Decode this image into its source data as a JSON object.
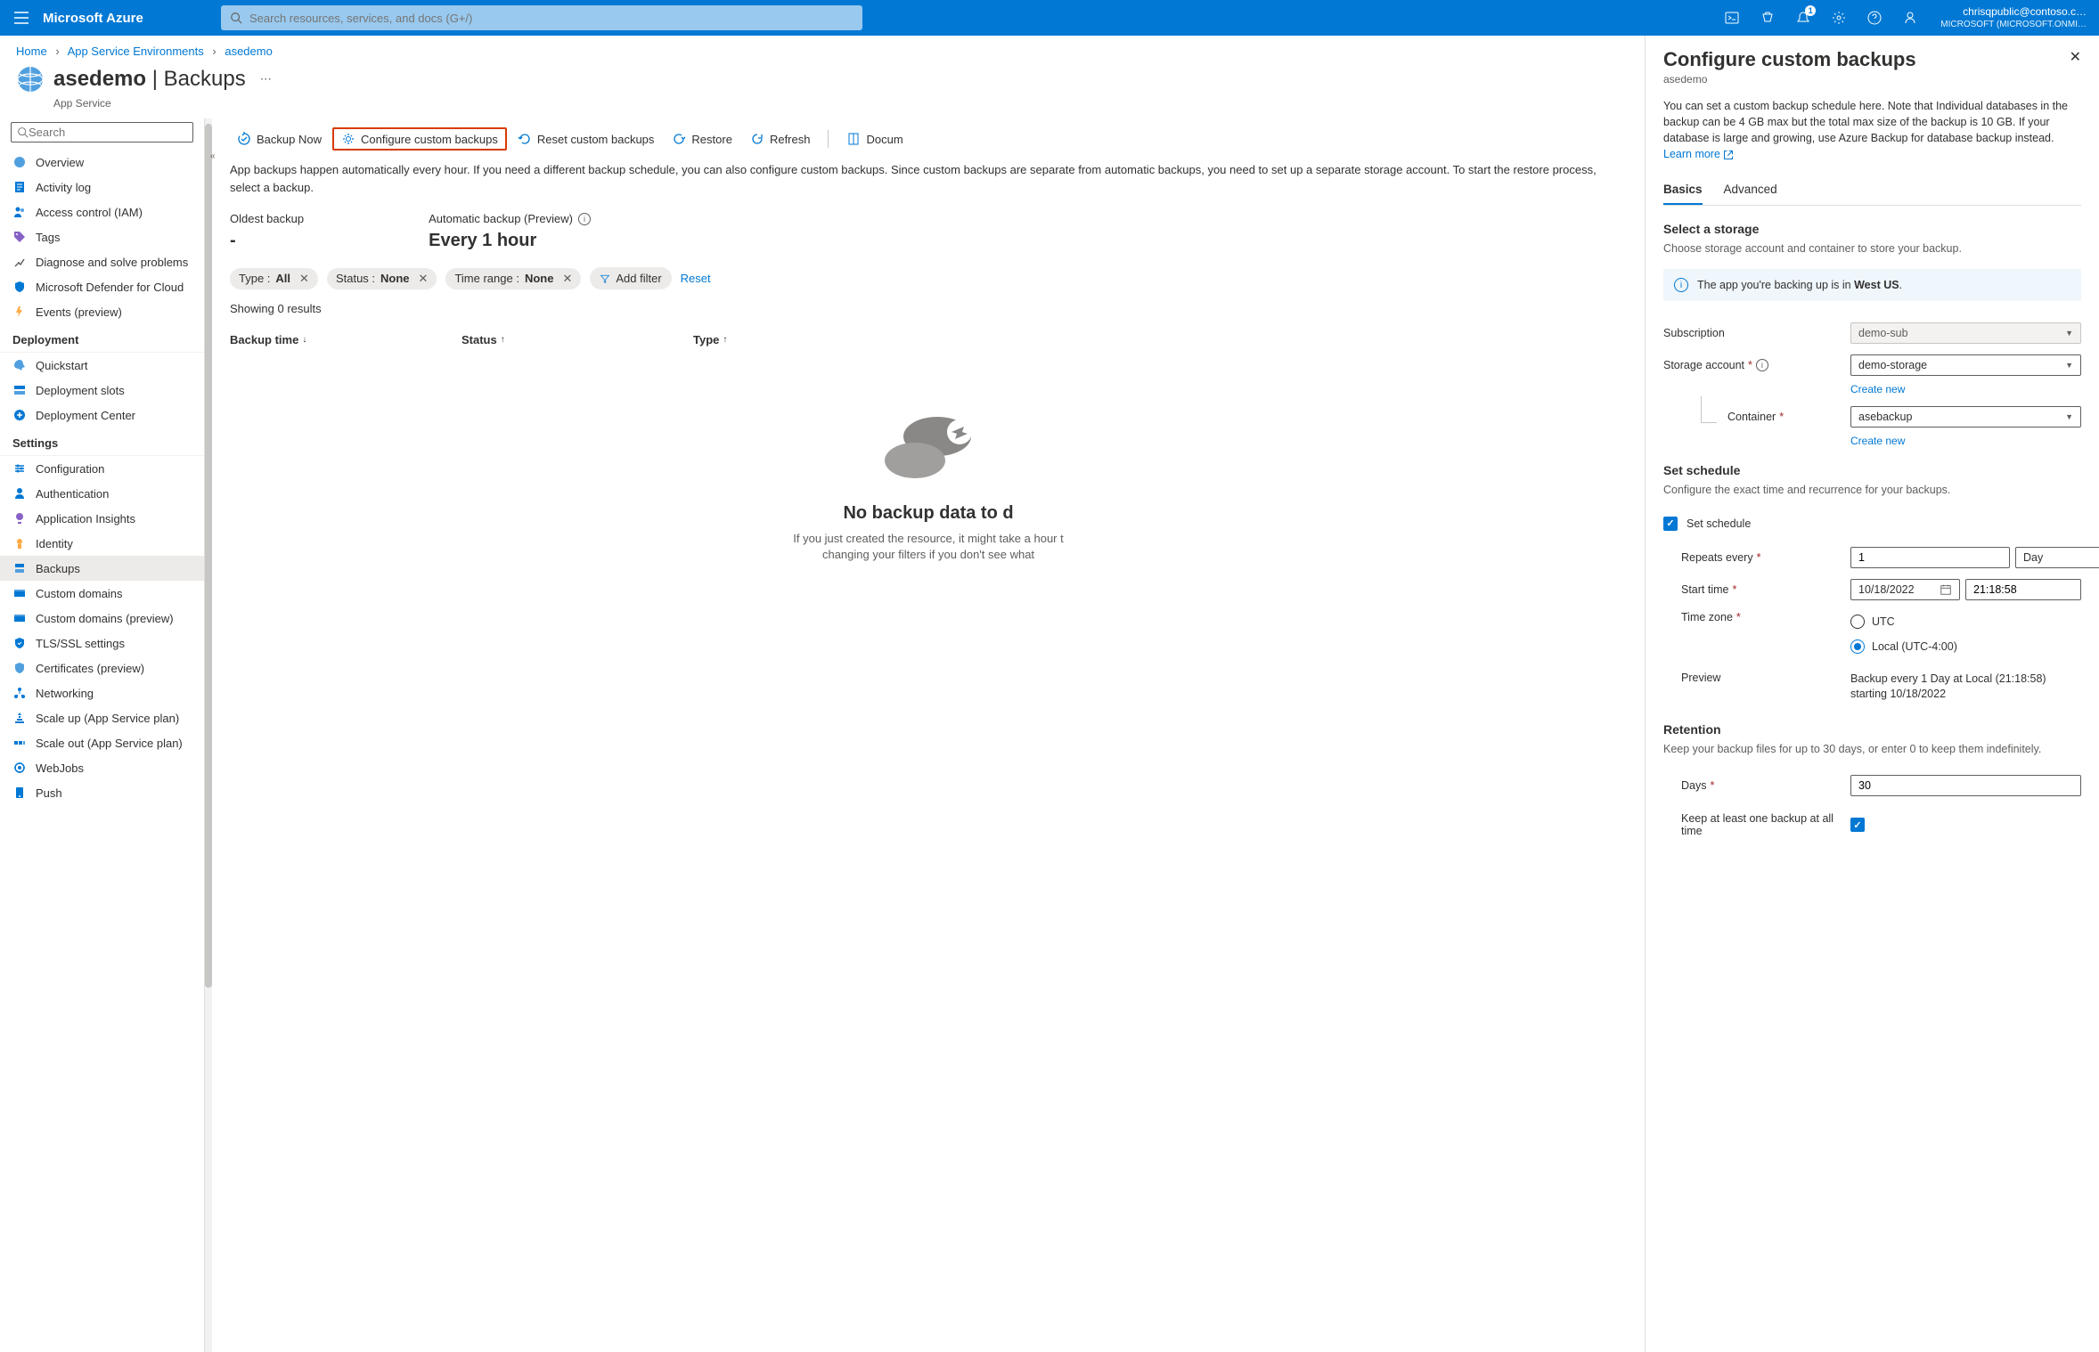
{
  "topbar": {
    "brand": "Microsoft Azure",
    "search_placeholder": "Search resources, services, and docs (G+/)",
    "notification_count": "1",
    "account_email": "chrisqpublic@contoso.c…",
    "account_tenant": "MICROSOFT (MICROSOFT.ONMI…"
  },
  "breadcrumb": {
    "items": [
      "Home",
      "App Service Environments",
      "asedemo"
    ]
  },
  "page": {
    "title_primary": "asedemo",
    "title_secondary": "Backups",
    "service_kind": "App Service"
  },
  "left_search_placeholder": "Search",
  "menu": {
    "top": [
      {
        "icon": "overview",
        "label": "Overview"
      },
      {
        "icon": "log",
        "label": "Activity log"
      },
      {
        "icon": "iam",
        "label": "Access control (IAM)"
      },
      {
        "icon": "tags",
        "label": "Tags"
      },
      {
        "icon": "diagnose",
        "label": "Diagnose and solve problems"
      },
      {
        "icon": "defender",
        "label": "Microsoft Defender for Cloud"
      },
      {
        "icon": "events",
        "label": "Events (preview)"
      }
    ],
    "groups": [
      {
        "title": "Deployment",
        "items": [
          {
            "icon": "quickstart",
            "label": "Quickstart"
          },
          {
            "icon": "slots",
            "label": "Deployment slots"
          },
          {
            "icon": "depcenter",
            "label": "Deployment Center"
          }
        ]
      },
      {
        "title": "Settings",
        "items": [
          {
            "icon": "config",
            "label": "Configuration"
          },
          {
            "icon": "auth",
            "label": "Authentication"
          },
          {
            "icon": "insights",
            "label": "Application Insights"
          },
          {
            "icon": "identity",
            "label": "Identity"
          },
          {
            "icon": "backups",
            "label": "Backups",
            "active": true
          },
          {
            "icon": "domains",
            "label": "Custom domains"
          },
          {
            "icon": "domainsp",
            "label": "Custom domains (preview)"
          },
          {
            "icon": "tls",
            "label": "TLS/SSL settings"
          },
          {
            "icon": "certs",
            "label": "Certificates (preview)"
          },
          {
            "icon": "network",
            "label": "Networking"
          },
          {
            "icon": "scaleup",
            "label": "Scale up (App Service plan)"
          },
          {
            "icon": "scaleout",
            "label": "Scale out (App Service plan)"
          },
          {
            "icon": "webjobs",
            "label": "WebJobs"
          },
          {
            "icon": "push",
            "label": "Push"
          }
        ]
      }
    ]
  },
  "toolbar": {
    "backup_now": "Backup Now",
    "configure": "Configure custom backups",
    "reset": "Reset custom backups",
    "restore": "Restore",
    "refresh": "Refresh",
    "docs": "Docum"
  },
  "intro": "App backups happen automatically every hour. If you need a different backup schedule, you can also configure custom backups. Since custom backups are separate from automatic backups, you need to set up a separate storage account. To start the restore process, select a backup.",
  "stats": {
    "oldest_label": "Oldest backup",
    "oldest_value": "-",
    "auto_label": "Automatic backup (Preview)",
    "auto_value": "Every 1 hour"
  },
  "filters": {
    "type_label": "Type : ",
    "type_value": "All",
    "status_label": "Status : ",
    "status_value": "None",
    "time_label": "Time range : ",
    "time_value": "None",
    "add_filter": "Add filter",
    "reset": "Reset"
  },
  "results_count": "Showing 0 results",
  "columns": {
    "backup_time": "Backup time",
    "status": "Status",
    "type": "Type"
  },
  "empty": {
    "title": "No backup data to d",
    "sub1": "If you just created the resource, it might take a hour t",
    "sub2": "changing your filters if you don't see what"
  },
  "blade": {
    "title": "Configure custom backups",
    "resource": "asedemo",
    "desc": "You can set a custom backup schedule here. Note that Individual databases in the backup can be 4 GB max but the total max size of the backup is 10 GB. If your database is large and growing, use Azure Backup for database backup instead. ",
    "learn_more": "Learn more",
    "tabs": {
      "basics": "Basics",
      "advanced": "Advanced"
    },
    "storage": {
      "title": "Select a storage",
      "sub": "Choose storage account and container to store your backup.",
      "info_prefix": "The app you're backing up is in ",
      "info_region": "West US",
      "info_suffix": ".",
      "subscription_label": "Subscription",
      "subscription_value": "demo-sub",
      "account_label": "Storage account",
      "account_value": "demo-storage",
      "container_label": "Container",
      "container_value": "asebackup",
      "create_new": "Create new"
    },
    "schedule": {
      "title": "Set schedule",
      "sub": "Configure the exact time and recurrence for your backups.",
      "checkbox_label": "Set schedule",
      "repeats_label": "Repeats every",
      "repeats_value": "1",
      "repeats_unit": "Day",
      "start_label": "Start time",
      "start_date": "10/18/2022",
      "start_time": "21:18:58",
      "tz_label": "Time zone",
      "tz_utc": "UTC",
      "tz_local": "Local (UTC-4:00)",
      "preview_label": "Preview",
      "preview_text": "Backup every 1 Day at Local (21:18:58) starting 10/18/2022"
    },
    "retention": {
      "title": "Retention",
      "sub": "Keep your backup files for up to 30 days, or enter 0 to keep them indefinitely.",
      "days_label": "Days",
      "days_value": "30",
      "keep_one_label": "Keep at least one backup at all time"
    }
  }
}
